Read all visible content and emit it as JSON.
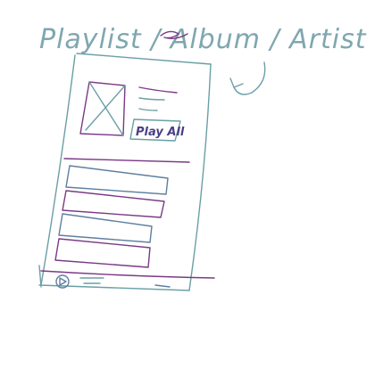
{
  "title": "Playlist / Album / Artist",
  "play_all_label": "Play All",
  "colors": {
    "teal_ink": "#6a9fa6",
    "purple_ink": "#7a3a86",
    "mixed_ink": "#5e7fa0"
  },
  "icons": [
    "image-placeholder-icon",
    "arrow-icon",
    "play-icon"
  ]
}
